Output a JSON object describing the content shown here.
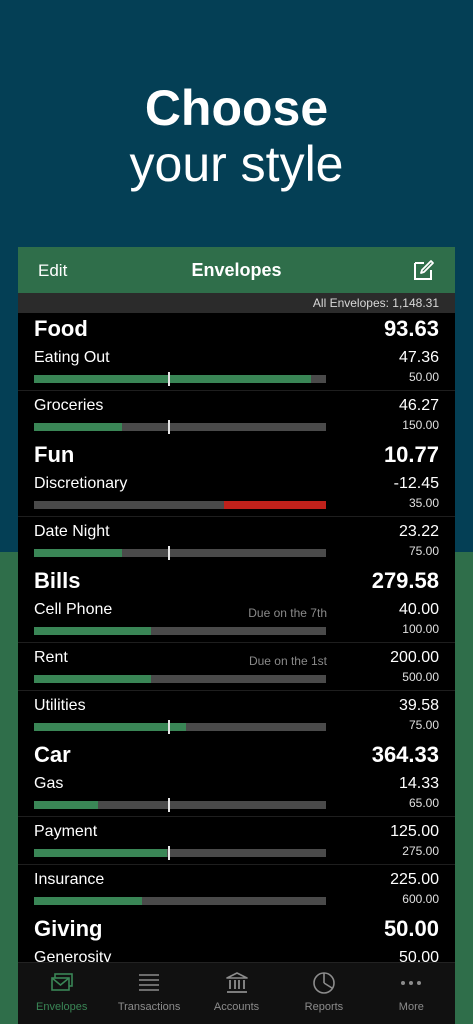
{
  "headline": {
    "line1": "Choose",
    "line2": "your style"
  },
  "navbar": {
    "edit_label": "Edit",
    "title": "Envelopes",
    "compose_icon": "compose-icon"
  },
  "all_envelopes": "All Envelopes: 1,148.31",
  "groups": [
    {
      "name": "Food",
      "total": "93.63",
      "envelopes": [
        {
          "name": "Eating Out",
          "due": "",
          "balance": "47.36",
          "budget": "50.00",
          "fill_fraction": 0.947,
          "marker_fraction": 0.46,
          "negative": false
        },
        {
          "name": "Groceries",
          "due": "",
          "balance": "46.27",
          "budget": "150.00",
          "fill_fraction": 0.3,
          "marker_fraction": 0.46,
          "negative": false
        }
      ]
    },
    {
      "name": "Fun",
      "total": "10.77",
      "envelopes": [
        {
          "name": "Discretionary",
          "due": "",
          "balance": "-12.45",
          "budget": "35.00",
          "fill_fraction": 0.35,
          "marker_fraction": null,
          "negative": true
        },
        {
          "name": "Date Night",
          "due": "",
          "balance": "23.22",
          "budget": "75.00",
          "fill_fraction": 0.3,
          "marker_fraction": 0.46,
          "negative": false
        }
      ]
    },
    {
      "name": "Bills",
      "total": "279.58",
      "envelopes": [
        {
          "name": "Cell Phone",
          "due": "Due on the 7th",
          "balance": "40.00",
          "budget": "100.00",
          "fill_fraction": 0.4,
          "marker_fraction": null,
          "negative": false
        },
        {
          "name": "Rent",
          "due": "Due on the 1st",
          "balance": "200.00",
          "budget": "500.00",
          "fill_fraction": 0.4,
          "marker_fraction": null,
          "negative": false
        },
        {
          "name": "Utilities",
          "due": "",
          "balance": "39.58",
          "budget": "75.00",
          "fill_fraction": 0.52,
          "marker_fraction": 0.46,
          "negative": false
        }
      ]
    },
    {
      "name": "Car",
      "total": "364.33",
      "envelopes": [
        {
          "name": "Gas",
          "due": "",
          "balance": "14.33",
          "budget": "65.00",
          "fill_fraction": 0.22,
          "marker_fraction": 0.46,
          "negative": false
        },
        {
          "name": "Payment",
          "due": "",
          "balance": "125.00",
          "budget": "275.00",
          "fill_fraction": 0.455,
          "marker_fraction": 0.46,
          "negative": false
        },
        {
          "name": "Insurance",
          "due": "",
          "balance": "225.00",
          "budget": "600.00",
          "fill_fraction": 0.37,
          "marker_fraction": null,
          "negative": false
        }
      ]
    },
    {
      "name": "Giving",
      "total": "50.00",
      "envelopes": [
        {
          "name": "Generosity",
          "due": "",
          "balance": "50.00",
          "budget": "",
          "fill_fraction": 0,
          "marker_fraction": null,
          "negative": false
        }
      ]
    }
  ],
  "tabs": [
    {
      "label": "Envelopes",
      "icon": "envelopes-icon",
      "active": true
    },
    {
      "label": "Transactions",
      "icon": "transactions-icon",
      "active": false
    },
    {
      "label": "Accounts",
      "icon": "accounts-icon",
      "active": false
    },
    {
      "label": "Reports",
      "icon": "reports-icon",
      "active": false
    },
    {
      "label": "More",
      "icon": "more-icon",
      "active": false
    }
  ],
  "colors": {
    "top_bg": "#043f55",
    "bottom_bg": "#2f6e4a",
    "accent": "#3a8656",
    "negative": "#c0211b"
  }
}
